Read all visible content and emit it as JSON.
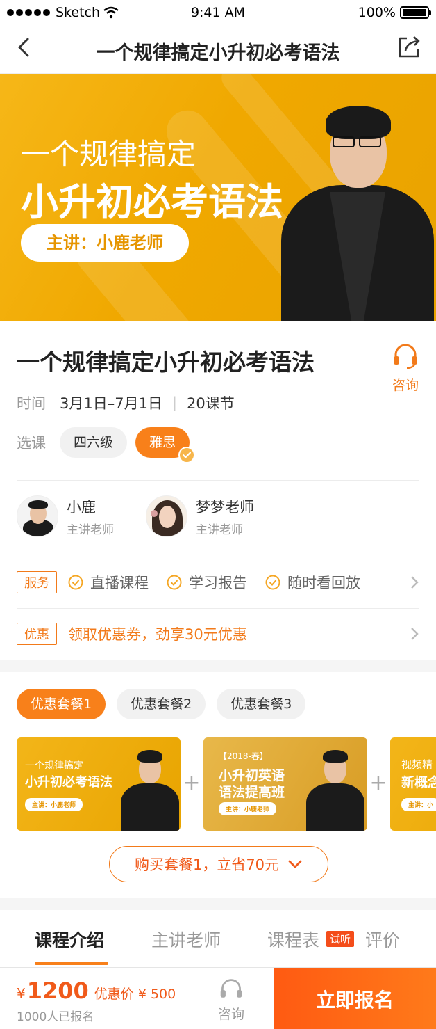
{
  "status_bar": {
    "carrier": "Sketch",
    "time": "9:41 AM",
    "battery": "100%"
  },
  "nav": {
    "title": "一个规律搞定小升初必考语法"
  },
  "banner": {
    "line1": "一个规律搞定",
    "line2": "小升初必考语法",
    "lecturer_pill": "主讲：小鹿老师"
  },
  "course": {
    "title": "一个规律搞定小升初必考语法",
    "consult_label": "咨询",
    "time_label": "时间",
    "date_range": "3月1日–7月1日",
    "separator": "|",
    "lessons": "20课节",
    "select_label": "选课",
    "options": [
      "四六级",
      "雅思"
    ],
    "selected_option": "雅思"
  },
  "teachers": [
    {
      "name": "小鹿",
      "role": "主讲老师"
    },
    {
      "name": "梦梦老师",
      "role": "主讲老师"
    }
  ],
  "services": {
    "tag": "服务",
    "items": [
      "直播课程",
      "学习报告",
      "随时看回放"
    ]
  },
  "discount": {
    "tag": "优惠",
    "text": "领取优惠券，劲享30元优惠"
  },
  "packages": {
    "tabs": [
      "优惠套餐1",
      "优惠套餐2",
      "优惠套餐3"
    ],
    "active_tab": "优惠套餐1",
    "cards": [
      {
        "small": "一个规律搞定",
        "big": "小升初必考语法",
        "pill": "主讲：小鹿老师"
      },
      {
        "small": "【2018-春】",
        "big": "小升初英语",
        "big2": "语法提高班",
        "pill": "主讲：小鹿老师"
      },
      {
        "small": "视频精",
        "big": "新概念",
        "pill": "主讲：小"
      }
    ],
    "plus": "+",
    "buy_label": "购买套餐1，立省70元"
  },
  "tabs": {
    "items": [
      "课程介绍",
      "主讲老师",
      "课程表",
      "评价"
    ],
    "active": "课程介绍",
    "trial_badge": "试听"
  },
  "bottom": {
    "currency": "¥",
    "price": "1200",
    "discount_price": "优惠价 ¥ 500",
    "enrolled": "1000人已报名",
    "consult_label": "咨询",
    "signup_label": "立即报名"
  },
  "colors": {
    "accent": "#f8801a",
    "banner": "#f0a800",
    "cta": "#ff5a12"
  }
}
